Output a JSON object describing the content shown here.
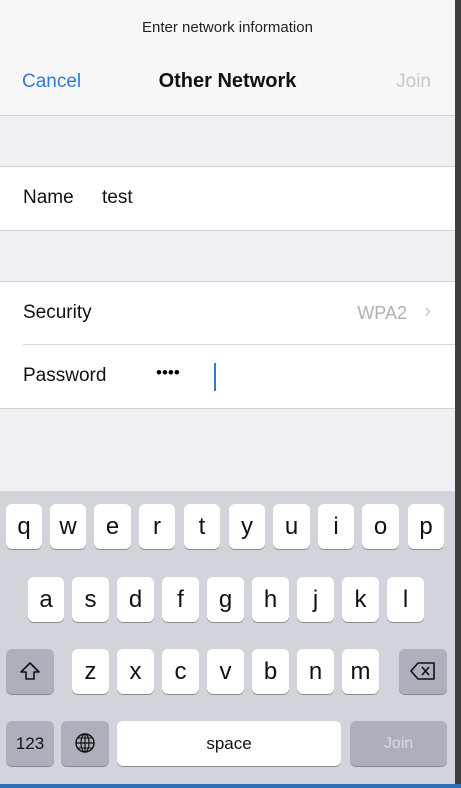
{
  "header": {
    "prompt": "Enter network information",
    "title": "Other Network",
    "cancel_label": "Cancel",
    "join_label": "Join"
  },
  "form": {
    "name_label": "Name",
    "name_value": "test",
    "security_label": "Security",
    "security_value": "WPA2",
    "password_label": "Password",
    "password_value": "••••"
  },
  "keyboard": {
    "row1": [
      "q",
      "w",
      "e",
      "r",
      "t",
      "y",
      "u",
      "i",
      "o",
      "p"
    ],
    "row2": [
      "a",
      "s",
      "d",
      "f",
      "g",
      "h",
      "j",
      "k",
      "l"
    ],
    "row3": [
      "z",
      "x",
      "c",
      "v",
      "b",
      "n",
      "m"
    ],
    "numbers_label": "123",
    "space_label": "space",
    "join_label": "Join",
    "shift_icon": "shift-icon",
    "delete_icon": "delete-icon",
    "globe_icon": "globe-icon"
  },
  "colors": {
    "accent": "#2f7bd3",
    "disabled": "#c7c7cc",
    "background": "#efeff4",
    "keyboard": "#d1d4da"
  }
}
